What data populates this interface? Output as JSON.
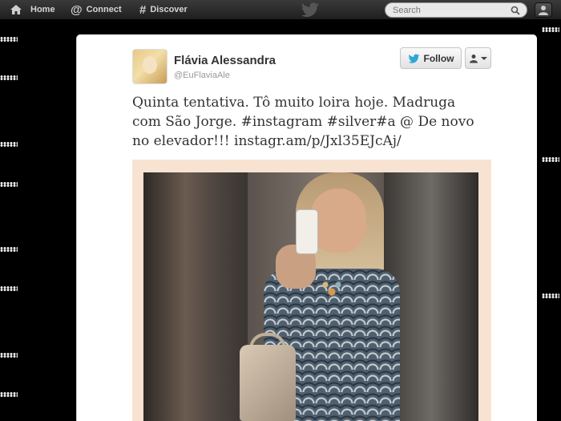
{
  "topbar": {
    "home_label": "Home",
    "connect_label": "Connect",
    "discover_label": "Discover",
    "search_placeholder": "Search"
  },
  "tweet": {
    "full_name": "Flávia Alessandra",
    "screen_name": "@EuFlaviaAle",
    "follow_label": "Follow",
    "text_line1": "Quinta tentativa. Tô muito loira hoje. Madruga",
    "text_line2": "com São Jorge. ",
    "hashtag_instagram": "#instagram",
    "hashtag_silver": "#silver#a",
    "text_after_tags": " @ De novo",
    "text_line3": "no elevador!!! ",
    "link": "instagr.am/p/Jxl35EJcAj/"
  },
  "colors": {
    "topbar": "#2a2a2a",
    "follow_bird": "#2fa5d8",
    "page_bg": "#000000",
    "card_bg": "#ffffff"
  }
}
